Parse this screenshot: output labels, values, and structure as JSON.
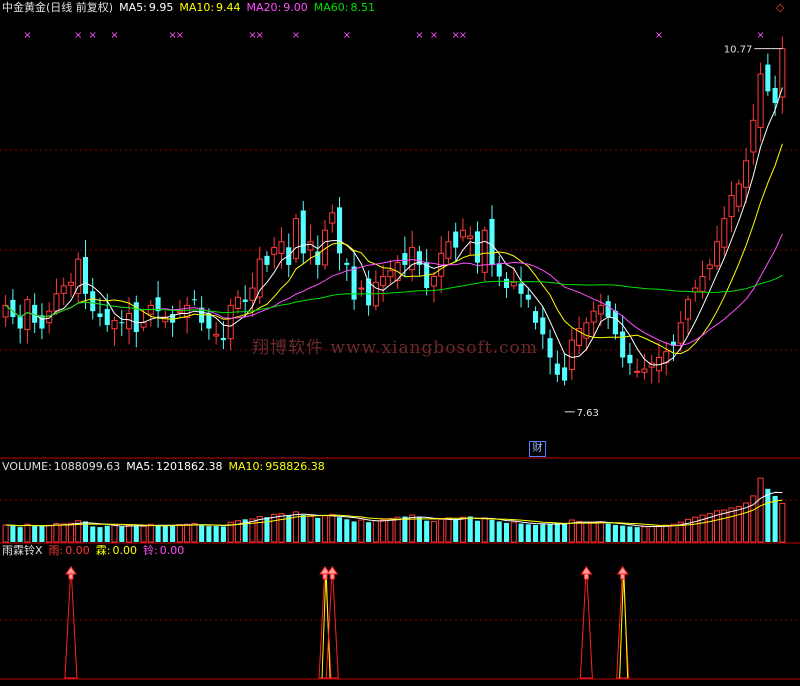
{
  "header": {
    "title": "中金黄金(日线 前复权)",
    "ma5_label": "MA5:",
    "ma5_value": "9.95",
    "ma10_label": "MA10:",
    "ma10_value": "9.44",
    "ma20_label": "MA20:",
    "ma20_value": "9.00",
    "ma60_label": "MA60:",
    "ma60_value": "8.51"
  },
  "volume_header": {
    "label": "VOLUME:",
    "value": "1088099.63",
    "ma5_label": "MA5:",
    "ma5_value": "1201862.38",
    "ma10_label": "MA10:",
    "ma10_value": "958826.38"
  },
  "indicator_header": {
    "name": "雨霖铃X",
    "s1_label": "雨:",
    "s1_value": "0.00",
    "s2_label": "霖:",
    "s2_value": "0.00",
    "s3_label": "铃:",
    "s3_value": "0.00"
  },
  "annotations": {
    "high_label": "10.77",
    "low_label": "7.63",
    "cai_badge": "财",
    "watermark": "翔博软件 www.xiangbosoft.com"
  },
  "colors": {
    "up": "#ff3a3a",
    "down": "#54ffff",
    "ma5": "#ffffff",
    "ma10": "#ffff00",
    "ma20": "#ff50ff",
    "ma60": "#00e000",
    "grid": "#8b0000",
    "marker": "#ff50ff"
  },
  "chart_data": [
    {
      "type": "candlestick",
      "title": "中金黄金(日线 前复权)",
      "price_range": [
        7.3,
        11.0
      ],
      "high": 10.77,
      "low": 7.63,
      "moving_averages": {
        "MA5": 9.95,
        "MA10": 9.44,
        "MA20": 9.0,
        "MA60": 8.51
      },
      "grid": true,
      "close": [
        8.55,
        8.45,
        8.35,
        8.6,
        8.4,
        8.35,
        8.5,
        8.65,
        8.72,
        8.75,
        8.95,
        8.65,
        8.5,
        8.45,
        8.38,
        8.42,
        8.4,
        8.48,
        8.32,
        8.4,
        8.55,
        8.5,
        8.45,
        8.4,
        8.5,
        8.55,
        8.6,
        8.4,
        8.35,
        8.3,
        8.25,
        8.55,
        8.62,
        8.58,
        8.7,
        8.95,
        8.9,
        9.05,
        9.1,
        8.9,
        9.3,
        9.0,
        9.1,
        8.9,
        9.2,
        9.35,
        9.0,
        8.9,
        8.6,
        8.7,
        8.55,
        8.75,
        8.8,
        8.85,
        8.92,
        8.9,
        9.05,
        8.9,
        8.7,
        8.8,
        9.0,
        9.1,
        9.05,
        9.2,
        9.15,
        8.92,
        9.2,
        8.9,
        8.8,
        8.7,
        8.75,
        8.65,
        8.6,
        8.4,
        8.3,
        8.1,
        7.95,
        7.9,
        8.25,
        8.35,
        8.4,
        8.5,
        8.55,
        8.45,
        8.3,
        8.1,
        8.05,
        7.98,
        8.0,
        8.05,
        8.1,
        8.15,
        8.2,
        8.4,
        8.6,
        8.7,
        8.8,
        8.9,
        9.1,
        9.3,
        9.5,
        9.6,
        9.8,
        10.15,
        10.55,
        10.4,
        10.3,
        10.77
      ]
    },
    {
      "type": "bar",
      "title": "VOLUME",
      "value": 1088099.63,
      "MA5": 1201862.38,
      "MA10": 958826.38,
      "values": [
        480000,
        470000,
        420000,
        500000,
        460000,
        450000,
        470000,
        520000,
        510000,
        530000,
        600000,
        580000,
        440000,
        420000,
        460000,
        470000,
        430000,
        480000,
        460000,
        440000,
        500000,
        480000,
        470000,
        460000,
        490000,
        500000,
        520000,
        470000,
        450000,
        450000,
        440000,
        560000,
        600000,
        640000,
        650000,
        720000,
        700000,
        780000,
        800000,
        740000,
        850000,
        760000,
        720000,
        680000,
        740000,
        780000,
        700000,
        640000,
        580000,
        620000,
        560000,
        600000,
        620000,
        660000,
        700000,
        720000,
        760000,
        690000,
        600000,
        580000,
        640000,
        680000,
        650000,
        700000,
        720000,
        600000,
        680000,
        620000,
        580000,
        540000,
        560000,
        520000,
        500000,
        480000,
        500000,
        520000,
        540000,
        500000,
        620000,
        580000,
        560000,
        540000,
        560000,
        520000,
        480000,
        460000,
        440000,
        420000,
        430000,
        440000,
        460000,
        470000,
        500000,
        560000,
        640000,
        700000,
        760000,
        800000,
        880000,
        900000,
        960000,
        1000000,
        1100000,
        1300000,
        1800000,
        1500000,
        1300000,
        1088099.63
      ]
    },
    {
      "type": "line",
      "title": "雨霖铃X",
      "series": [
        {
          "name": "雨",
          "value": 0.0
        },
        {
          "name": "霖",
          "value": 0.0
        },
        {
          "name": "铃",
          "value": 0.0
        }
      ],
      "signal_bars": [
        9,
        44,
        45,
        80,
        85,
        113,
        129,
        131,
        134
      ]
    }
  ]
}
